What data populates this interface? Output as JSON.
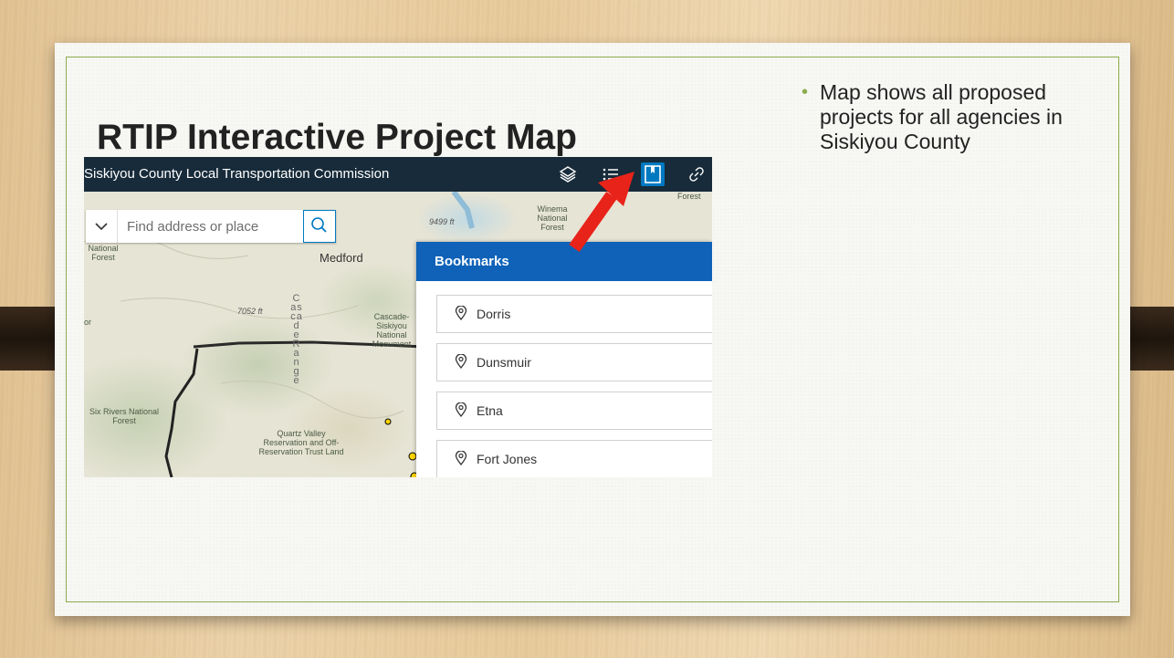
{
  "slide": {
    "title": "RTIP Interactive Project Map",
    "bullet": "Map shows all proposed projects for all agencies in Siskiyou County",
    "accent_color": "#8cac4c"
  },
  "app": {
    "title": "Siskiyou County Local Transportation Commission",
    "bar_color": "#172b3a",
    "toolbar_icons": [
      "layers-icon",
      "legend-list-icon",
      "bookmarks-icon",
      "share-link-icon"
    ],
    "active_icon": "bookmarks-icon"
  },
  "search": {
    "placeholder": "Find address or place"
  },
  "bookmarks": {
    "title": "Bookmarks",
    "items": [
      {
        "label": "Dorris"
      },
      {
        "label": "Dunsmuir"
      },
      {
        "label": "Etna"
      },
      {
        "label": "Fort Jones"
      }
    ]
  },
  "map": {
    "labels": {
      "forest": "Forest",
      "winema": "Winema National Forest",
      "elev9499": "9499 ft",
      "natforest": "National Forest",
      "medford": "Medford",
      "elev7052": "7052 ft",
      "cascade_siskiyou": "Cascade-Siskiyou National Monument",
      "cascade_range": "Cascade Range",
      "or": "or",
      "six_rivers": "Six Rivers National Forest",
      "quartz_valley": "Quartz Valley Reservation and Off-Reservation Trust Land"
    }
  },
  "annotation": {
    "arrow_color": "#e8231a",
    "points_to": "bookmarks-icon"
  }
}
